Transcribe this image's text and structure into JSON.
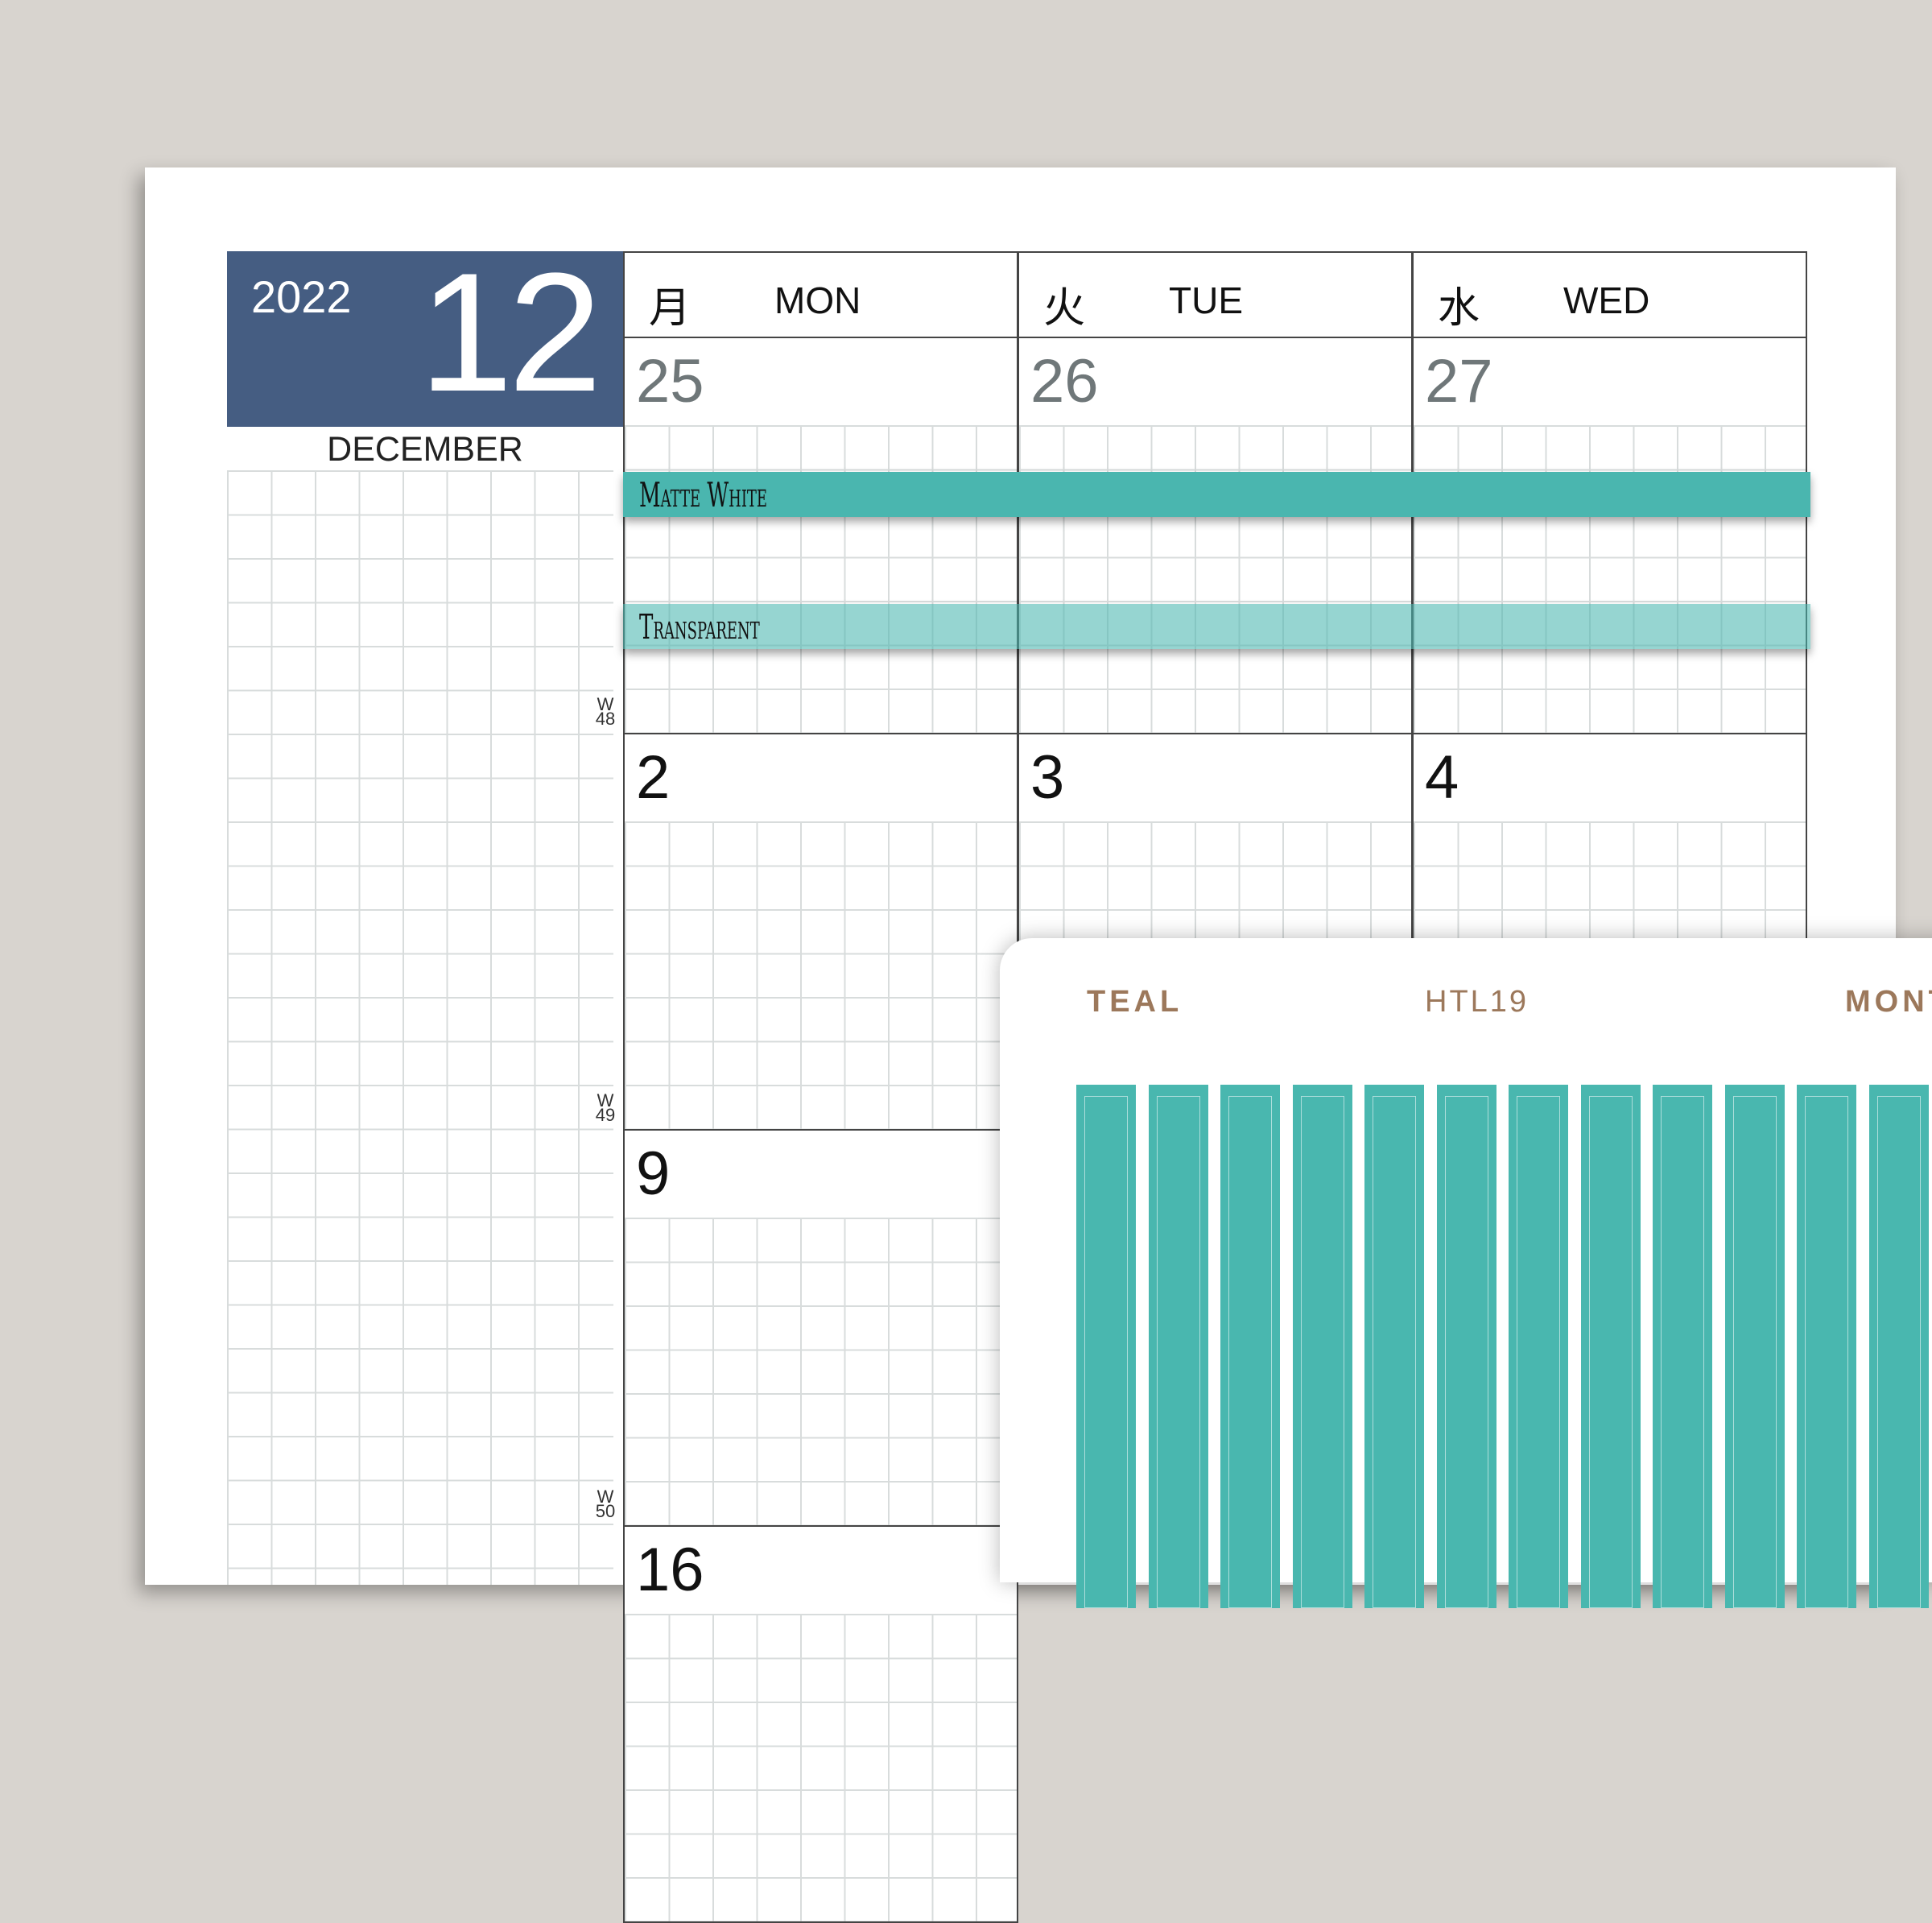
{
  "planner": {
    "year": "2022",
    "month_number": "12",
    "month_name": "DECEMBER",
    "week_labels": [
      {
        "w": "W",
        "n": "48"
      },
      {
        "w": "W",
        "n": "49"
      },
      {
        "w": "W",
        "n": "50"
      }
    ],
    "day_headers": [
      {
        "jp": "月",
        "en": "MON"
      },
      {
        "jp": "火",
        "en": "TUE"
      },
      {
        "jp": "水",
        "en": "WED"
      }
    ],
    "weeks": [
      [
        "25",
        "26",
        "27"
      ],
      [
        "2",
        "3",
        "4"
      ],
      [
        "9",
        "",
        ""
      ],
      [
        "16",
        "",
        ""
      ]
    ]
  },
  "tapes": {
    "matte_label": "Matte White",
    "transparent_label": "Transparent"
  },
  "sticker_sheet": {
    "color_label": "TEAL",
    "code_label": "HTL19",
    "type_label": "MONT",
    "strip_color": "#49b7af",
    "strip_count": 12
  }
}
